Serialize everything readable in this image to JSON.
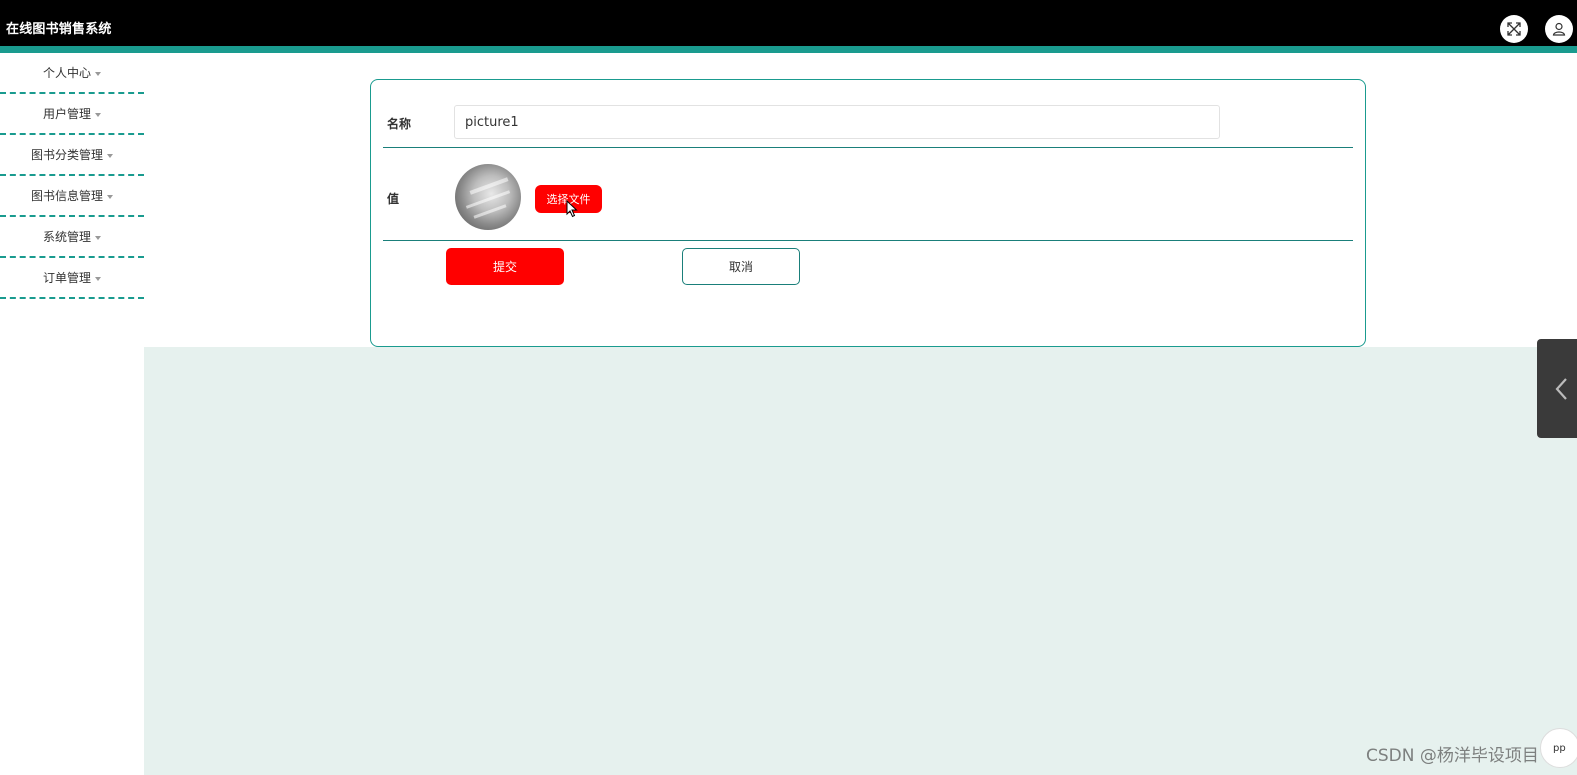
{
  "app": {
    "title": "在线图书销售系统"
  },
  "header": {
    "fullscreen_icon": "fullscreen-icon",
    "user_icon": "user-icon"
  },
  "sidebar": {
    "items": [
      {
        "label": "个人中心"
      },
      {
        "label": "用户管理"
      },
      {
        "label": "图书分类管理"
      },
      {
        "label": "图书信息管理"
      },
      {
        "label": "系统管理"
      },
      {
        "label": "订单管理"
      }
    ]
  },
  "form": {
    "name_label": "名称",
    "name_value": "picture1",
    "value_label": "值",
    "choose_file_label": "选择文件",
    "submit_label": "提交",
    "cancel_label": "取消"
  },
  "colors": {
    "accent": "#1a9b8f",
    "primary_button": "#ff0000",
    "topbar": "#000000",
    "content_bg": "#e6f1ee"
  },
  "watermark": "CSDN @杨洋毕设项目",
  "corner_button": "pp"
}
